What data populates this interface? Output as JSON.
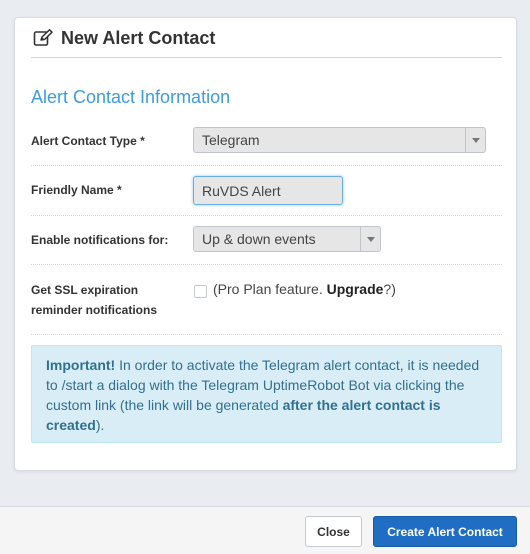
{
  "modal": {
    "title": "New Alert Contact",
    "section_title": "Alert Contact Information"
  },
  "form": {
    "type_label": "Alert Contact Type *",
    "type_value": "Telegram",
    "friendly_name_label": "Friendly Name *",
    "friendly_name_value": "RuVDS Alert",
    "notifications_label": "Enable notifications for:",
    "notifications_value": "Up & down events",
    "ssl_label_line1": "Get SSL expiration",
    "ssl_label_line2": "reminder notifications",
    "ssl_checked": false,
    "ssl_note_prefix": "(Pro Plan feature. ",
    "ssl_note_link": "Upgrade",
    "ssl_note_suffix": "?)"
  },
  "info": {
    "important": "Important!",
    "text_1": " In order to activate the Telegram alert contact, it is needed to /start a dialog with the Telegram UptimeRobot Bot via clicking the custom link (the link will be generated ",
    "emphasis": "after the alert contact is created",
    "text_2": ")."
  },
  "footer": {
    "close_label": "Close",
    "create_label": "Create Alert Contact"
  },
  "colors": {
    "accent": "#3d9be0",
    "primary_button": "#1f6ec4",
    "info_bg": "#d9edf7",
    "info_text": "#31708f"
  },
  "icons": {
    "header": "edit-icon"
  }
}
